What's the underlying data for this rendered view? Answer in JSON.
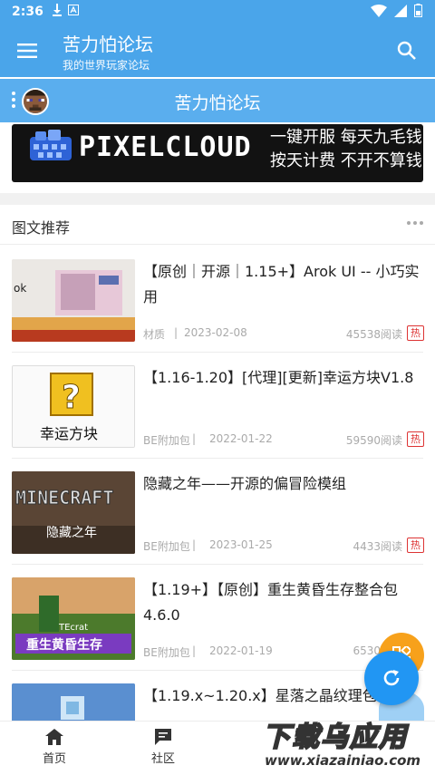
{
  "status": {
    "time": "2:36"
  },
  "appbar": {
    "title": "苦力怕论坛",
    "subtitle": "我的世界玩家论坛"
  },
  "subbar": {
    "title": "苦力怕论坛"
  },
  "banner": {
    "brand": "PIXELCLOUD",
    "slogan1": "一键开服 每天九毛钱",
    "slogan2": "按天计费 不开不算钱"
  },
  "section": {
    "title": "图文推荐"
  },
  "items": [
    {
      "title": "【原创｜开源｜1.15+】Arok UI -- 小巧实用",
      "category": "材质",
      "date": "2023-02-08",
      "views": "45538阅读",
      "hot": "热",
      "thumb_color": "#e9e7e4"
    },
    {
      "title": "【1.16-1.20】[代理][更新]幸运方块V1.8",
      "category": "BE附加包",
      "date": "2022-01-22",
      "views": "59590阅读",
      "hot": "热",
      "thumb_color": "#f4f4f4"
    },
    {
      "title": "隐藏之年——开源的偏冒险模组",
      "category": "BE附加包",
      "date": "2023-01-25",
      "views": "4433阅读",
      "hot": "热",
      "thumb_color": "#4f3b2e"
    },
    {
      "title": "【1.19+】【原创】重生黄昏生存整合包4.6.0",
      "category": "BE附加包",
      "date": "2022-01-19",
      "views": "6530",
      "hot": "",
      "thumb_color": "#6a8a3a"
    },
    {
      "title": "【1.19.x~1.20.x】星落之晶纹理包",
      "category": "",
      "date": "",
      "views": "",
      "hot": "",
      "thumb_color": "#5a8fd0"
    }
  ],
  "nav": {
    "home": "首页",
    "community": "社区"
  },
  "watermark": {
    "line1": "下载乌应用",
    "line2": "www.xiazainiao.com"
  },
  "colors": {
    "primary": "#4aa5ea",
    "hot": "#d33333",
    "fab": "#2196f3",
    "fab_secondary": "#f7a11b"
  }
}
